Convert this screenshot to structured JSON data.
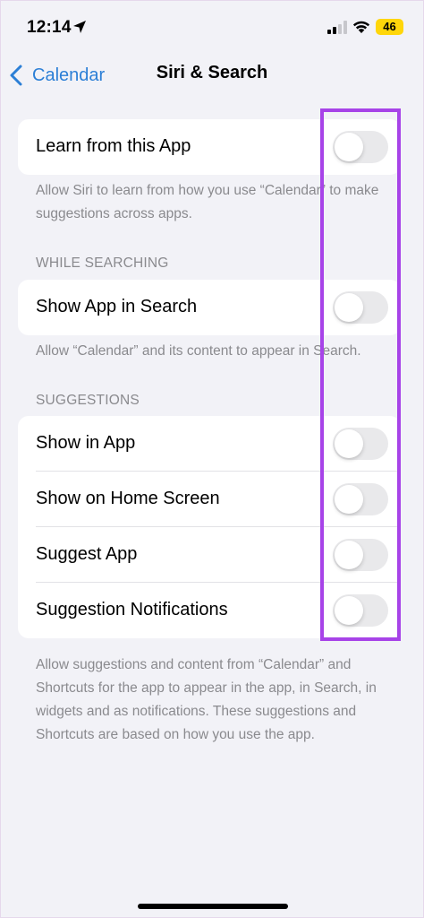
{
  "status_bar": {
    "time": "12:14",
    "battery": "46",
    "colors": {
      "battery": "#ffd60a"
    },
    "icons": [
      "location-arrow-icon",
      "cellular-signal-icon",
      "wifi-icon",
      "battery-icon"
    ]
  },
  "nav": {
    "back_label": "Calendar",
    "title": "Siri & Search",
    "accent": "#2c7fd6"
  },
  "learn_section": {
    "row": {
      "label": "Learn from this App",
      "on": false
    },
    "footer": "Allow Siri to learn from how you use “Calendar” to make suggestions across apps."
  },
  "searching_section": {
    "header": "WHILE SEARCHING",
    "row": {
      "label": "Show App in Search",
      "on": false
    },
    "footer": "Allow “Calendar” and its content to appear in Search."
  },
  "suggestions_section": {
    "header": "SUGGESTIONS",
    "rows": [
      {
        "label": "Show in App",
        "on": false
      },
      {
        "label": "Show on Home Screen",
        "on": false
      },
      {
        "label": "Suggest App",
        "on": false
      },
      {
        "label": "Suggestion Notifications",
        "on": false
      }
    ],
    "footer": "Allow suggestions and content from “Calendar” and Shortcuts for the app to appear in the app, in Search, in widgets and as notifications. These suggestions and Shortcuts are based on how you use the app."
  },
  "annotation": {
    "color": "#a743e8"
  }
}
